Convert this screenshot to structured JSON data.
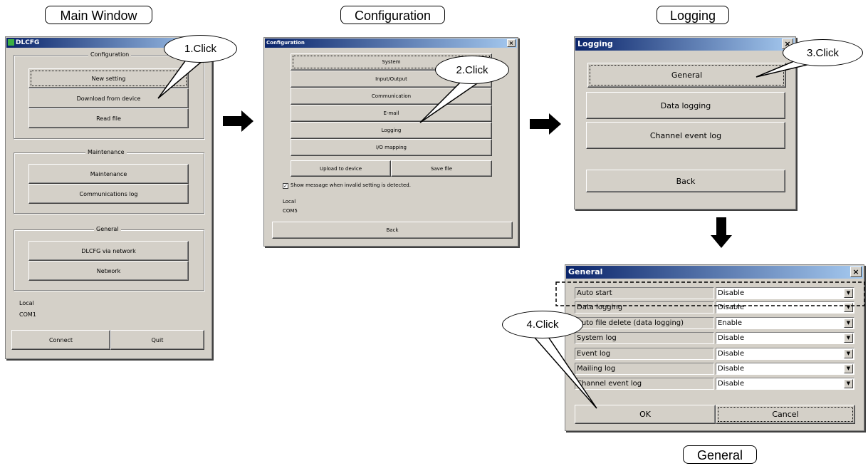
{
  "labels": {
    "main_window": "Main Window",
    "configuration": "Configuration",
    "logging": "Logging",
    "general": "General"
  },
  "callouts": [
    "1.Click",
    "2.Click",
    "3.Click",
    "4.Click"
  ],
  "main_window": {
    "title": "DLCFG",
    "configuration_group": "Configuration",
    "buttons_config": [
      "New setting",
      "Download from device",
      "Read file"
    ],
    "maintenance_group": "Maintenance",
    "buttons_maintenance": [
      "Maintenance",
      "Communications log"
    ],
    "general_group": "General",
    "buttons_general": [
      "DLCFG via network",
      "Network"
    ],
    "status_line1": "Local",
    "status_line2": "COM1",
    "connect_label": "Connect",
    "quit_label": "Quit"
  },
  "configuration_window": {
    "title": "Configuration",
    "close": "×",
    "buttons": [
      "System",
      "Input/Output",
      "Communication",
      "E-mail",
      "Logging",
      "I/O mapping"
    ],
    "upload_label": "Upload to device",
    "save_label": "Save file",
    "checkbox_label": "Show message when invalid setting is detected.",
    "checkbox_mark": "✓",
    "status_line1": "Local",
    "status_line2": "COM5",
    "back_label": "Back"
  },
  "logging_window": {
    "title": "Logging",
    "close": "×",
    "buttons": [
      "General",
      "Data logging",
      "Channel event log"
    ],
    "back_label": "Back"
  },
  "general_window": {
    "title": "General",
    "close": "×",
    "rows": [
      {
        "label": "Auto start",
        "value": "Disable"
      },
      {
        "label": "Data logging",
        "value": "Disable"
      },
      {
        "label": "Auto file delete (data logging)",
        "value": "Enable"
      },
      {
        "label": "System log",
        "value": "Disable"
      },
      {
        "label": "Event log",
        "value": "Disable"
      },
      {
        "label": "Mailing log",
        "value": "Disable"
      },
      {
        "label": "Channel event log",
        "value": "Disable"
      }
    ],
    "dropdown_arrow": "▼",
    "ok_label": "OK",
    "cancel_label": "Cancel"
  },
  "colors": {
    "window_bg": "#d4d0c8",
    "title_gradient_start": "#0a246a",
    "title_gradient_end": "#a6caf0"
  }
}
